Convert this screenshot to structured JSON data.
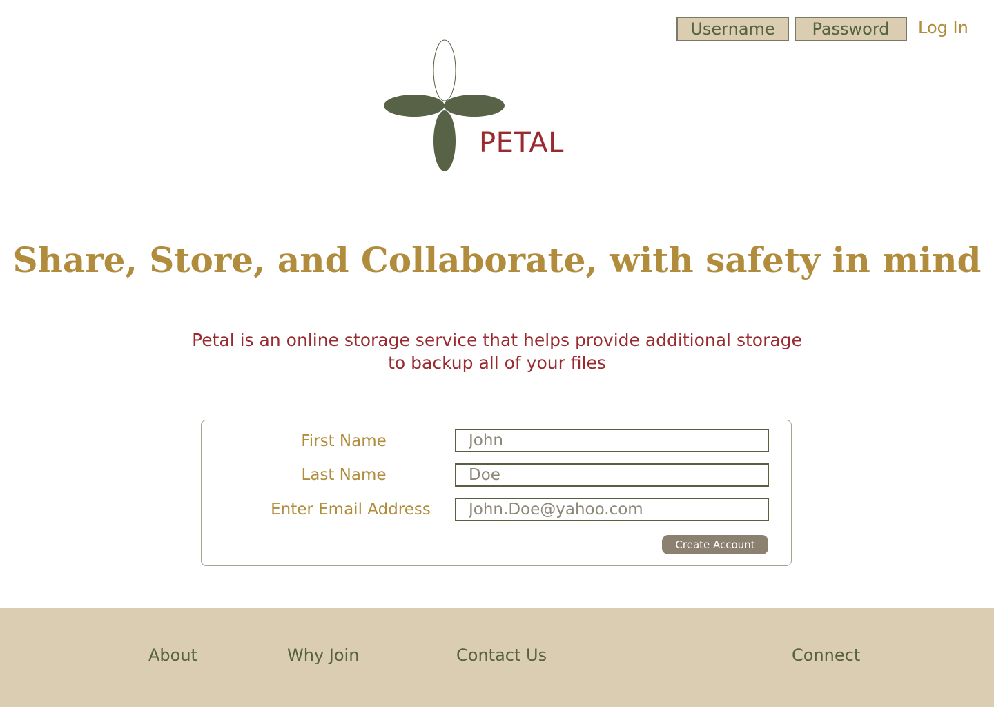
{
  "header": {
    "username_label": "Username",
    "password_label": "Password",
    "login_label": "Log In"
  },
  "brand": {
    "name": "PETAL"
  },
  "hero": {
    "title": "Share, Store, and Collaborate, with safety in mind",
    "description": "Petal is an online storage service that helps provide additional storage to backup all of your files"
  },
  "signup_form": {
    "first_name_label": "First Name",
    "first_name_value": "John",
    "last_name_label": "Last Name",
    "last_name_value": "Doe",
    "email_label": "Enter Email Address",
    "email_value": "John.Doe@yahoo.com",
    "submit_label": "Create Account"
  },
  "footer": {
    "links": [
      "About",
      "Why Join",
      "Contact Us",
      "Connect"
    ]
  },
  "colors": {
    "gold": "#b08c3c",
    "crimson": "#982a30",
    "olive": "#55613f",
    "sand": "#dacdb1",
    "taupe": "#8c8070"
  }
}
